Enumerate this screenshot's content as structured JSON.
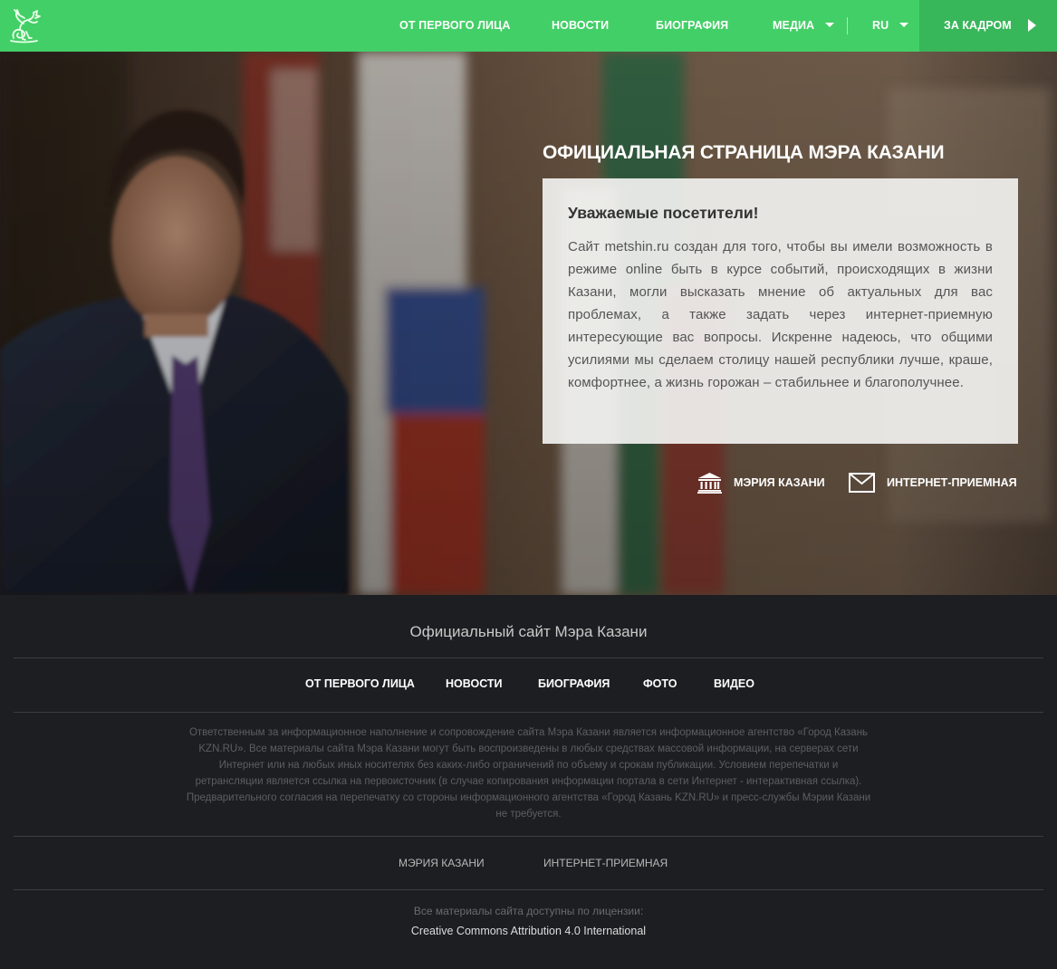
{
  "colors": {
    "nav_bg": "#43cf67",
    "nav_active_bg": "#38b65a",
    "footer_bg": "#1d1e21"
  },
  "header": {
    "logo_icon": "kazan-zilant-dragon-icon",
    "nav": [
      {
        "label": "ОТ ПЕРВОГО ЛИЦА"
      },
      {
        "label": "НОВОСТИ"
      },
      {
        "label": "БИОГРАФИЯ"
      },
      {
        "label": "МЕДИА",
        "dropdown": true
      },
      {
        "label": "RU",
        "dropdown": true
      }
    ],
    "behind_the_scenes": "ЗА КАДРОМ"
  },
  "hero": {
    "title": "ОФИЦИАЛЬНАЯ СТРАНИЦА МЭРА КАЗАНИ",
    "welcome": {
      "heading": "Уважаемые посетители!",
      "text": "Сайт metshin.ru создан для того, чтобы вы имели возможность в режиме online быть в курсе событий, происходящих в жизни Казани, могли высказать мнение об актуальных для вас проблемах, а также задать через интернет-приемную интересующие вас вопросы. Искренне надеюсь, что общими усилиями мы сделаем столицу нашей республики лучше, краше, комфортнее, а жизнь горожан – стабильнее и благополучнее."
    },
    "links": [
      {
        "label": "МЭРИЯ КАЗАНИ",
        "icon": "city-hall-icon"
      },
      {
        "label": "ИНТЕРНЕТ-ПРИЕМНАЯ",
        "icon": "envelope-icon"
      }
    ]
  },
  "footer": {
    "title": "Официальный сайт Мэра Казани",
    "nav": [
      {
        "label": "ОТ ПЕРВОГО ЛИЦА"
      },
      {
        "label": "НОВОСТИ"
      },
      {
        "label": "БИОГРАФИЯ"
      },
      {
        "label": "ФОТО"
      },
      {
        "label": "ВИДЕО"
      }
    ],
    "disclaimer": "Ответственным за информационное наполнение и сопровождение сайта Мэра Казани является информационное агентство «Город Казань KZN.RU». Все материалы сайта Мэра Казани могут быть воспроизведены в любых средствах массовой информации, на серверах сети Интернет или на любых иных носителях без каких-либо ограничений по объему и срокам публикации. Условием перепечатки и ретрансляции является ссылка на первоисточник (в случае копирования информации портала в сети Интернет - интерактивная ссылка). Предварительного согласия на перепечатку со стороны информационного агентства «Город Казань KZN.RU» и пресс-службы Мэрии Казани не требуется.",
    "links": [
      {
        "label": "МЭРИЯ КАЗАНИ"
      },
      {
        "label": "ИНТЕРНЕТ-ПРИЕМНАЯ"
      }
    ],
    "license_label": "Все материалы сайта доступны по лицензии:",
    "license_link": "Creative Commons Attribution 4.0 International"
  }
}
